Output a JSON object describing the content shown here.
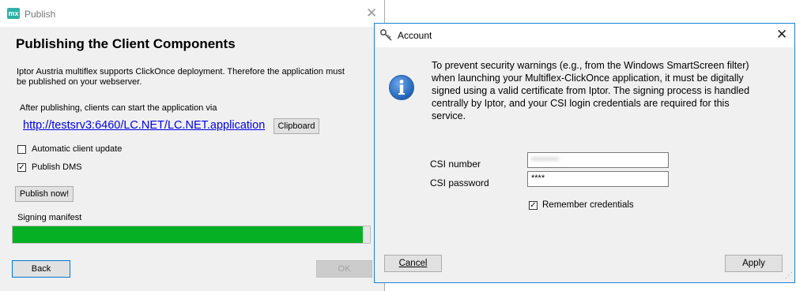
{
  "publish_window": {
    "app_icon_text": "mx",
    "title": "Publish",
    "heading": "Publishing the Client Components",
    "description_line1": "Iptor Austria multiflex supports ClickOnce deployment. Therefore the application must",
    "description_line2": "be published on your webserver.",
    "after_publishing_text": "After publishing, clients can start the application via",
    "url": "http://testsrv3:6460/LC.NET/LC.NET.application",
    "clipboard_label": "Clipboard",
    "automatic_update_label": "Automatic client update",
    "automatic_update_checked": false,
    "publish_dms_label": "Publish DMS",
    "publish_dms_checked": true,
    "publish_now_label": "Publish now!",
    "status_text": "Signing manifest",
    "progress_fraction": 0.98,
    "back_label": "Back",
    "ok_label": "OK"
  },
  "account_window": {
    "title": "Account",
    "message_lines": [
      "To prevent security warnings (e.g., from the Windows SmartScreen filter)",
      "when launching your Multiflex-ClickOnce application, it must be digitally",
      "signed using a valid certificate from Iptor. The signing process is handled",
      "centrally by Iptor, and your CSI login credentials are required for this",
      "service."
    ],
    "csi_number_label": "CSI number",
    "csi_number_value": "•••••••••",
    "csi_password_label": "CSI password",
    "csi_password_value": "****",
    "remember_label": "Remember credentials",
    "remember_checked": true,
    "cancel_label": "Cancel",
    "apply_label": "Apply"
  },
  "colors": {
    "progress_green": "#06b025",
    "link_blue": "#0000ee",
    "accent_border": "#1883d7",
    "info_icon_blue": "#1a5fb4"
  },
  "icons": [
    "app-mx-icon",
    "close-icon",
    "account-key-icon",
    "info-icon",
    "check-icon",
    "resize-grip-icon"
  ]
}
